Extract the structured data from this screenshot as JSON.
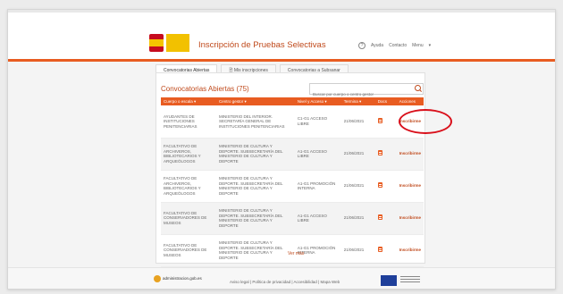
{
  "header": {
    "app_title": "Inscripción de Pruebas Selectivas",
    "nav": {
      "help": "Ayuda",
      "contact": "Contacto",
      "menu": "Menu"
    }
  },
  "tabs": [
    {
      "label": "Convocatorias Abiertas",
      "active": true
    },
    {
      "label": "Mis inscripciones",
      "active": false
    },
    {
      "label": "Convocatorias a Subsanar",
      "active": false
    }
  ],
  "section_title": "Convocatorias Abiertas (75)",
  "search": {
    "placeholder": "Buscar por cuerpo o centro gestor"
  },
  "table": {
    "headers": [
      "Cuerpo o escala",
      "Centro gestor",
      "Nivel y Acceso",
      "Termina",
      "Docs",
      "Acciones"
    ],
    "rows": [
      {
        "cuerpo": "AYUDANTES DE INSTITUCIONES PENITENCIARIAS",
        "centro": "MINISTERIO DEL INTERIOR. SECRETARÍA GENERAL DE INSTITUCIONES PENITENCIARIAS",
        "nivel": "C1-G1 ACCESO LIBRE",
        "termina": "21/06/2021",
        "accion": "Inscribirme"
      },
      {
        "cuerpo": "FACULTATIVO DE ARCHIVEROS, BIBLIOTECARIOS Y ARQUEÓLOGOS",
        "centro": "MINISTERIO DE CULTURA Y DEPORTE. SUBSECRETARÍA DEL MINISTERIO DE CULTURA Y DEPORTE",
        "nivel": "A1-G1 ACCESO LIBRE",
        "termina": "21/06/2021",
        "accion": "Inscribirme"
      },
      {
        "cuerpo": "FACULTATIVO DE ARCHIVEROS, BIBLIOTECARIOS Y ARQUEÓLOGOS",
        "centro": "MINISTERIO DE CULTURA Y DEPORTE. SUBSECRETARÍA DEL MINISTERIO DE CULTURA Y DEPORTE",
        "nivel": "A1-G1 PROMOCIÓN INTERNA",
        "termina": "21/06/2021",
        "accion": "Inscribirme"
      },
      {
        "cuerpo": "FACULTATIVO DE CONSERVADORES DE MUSEOS",
        "centro": "MINISTERIO DE CULTURA Y DEPORTE. SUBSECRETARÍA DEL MINISTERIO DE CULTURA Y DEPORTE",
        "nivel": "A1-G1 ACCESO LIBRE",
        "termina": "21/06/2021",
        "accion": "Inscribirme"
      },
      {
        "cuerpo": "FACULTATIVO DE CONSERVADORES DE MUSEOS",
        "centro": "MINISTERIO DE CULTURA Y DEPORTE. SUBSECRETARÍA DEL MINISTERIO DE CULTURA Y DEPORTE",
        "nivel": "A1-G1 PROMOCIÓN INTERNA",
        "termina": "21/06/2021",
        "accion": "Inscribirme"
      }
    ]
  },
  "ver_mas": "Ver más",
  "footer": {
    "logo_text": "administracion.gob.es",
    "links": "Aviso legal | Política de privacidad | Accesibilidad | Mapa Web"
  },
  "colors": {
    "accent": "#e85c21",
    "title": "#c04a1c",
    "highlight": "#d9101b"
  }
}
